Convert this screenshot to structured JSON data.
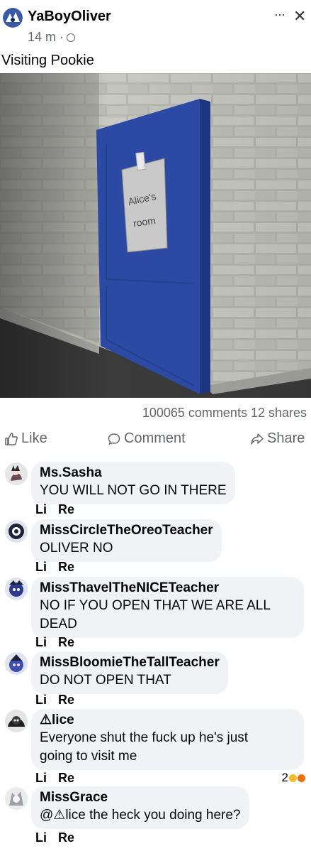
{
  "post": {
    "author": "YaBoyOliver",
    "time": "14 m ·",
    "caption": "Visiting Pookie",
    "more_icon": "···",
    "close_icon": "✕"
  },
  "image": {
    "sign_line1": "Alice's",
    "sign_line2": "room"
  },
  "stats": "100065 comments 12 shares",
  "actions": {
    "like": "Like",
    "comment": "Comment",
    "share": "Share"
  },
  "comments": [
    {
      "name": "Ms.Sasha",
      "lines": [
        "YOU WILL NOT GO IN THERE"
      ],
      "like": "Li",
      "reply": "Re"
    },
    {
      "name": "MissCircleTheOreoTeacher",
      "lines": [
        "OLIVER NO"
      ],
      "like": "Li",
      "reply": "Re"
    },
    {
      "name": "MissThavelTheNICETeacher",
      "lines": [
        "NO IF YOU OPEN THAT WE ARE ALL",
        "DEAD"
      ],
      "like": "Li",
      "reply": "Re"
    },
    {
      "name": "MissBloomieTheTallTeacher",
      "lines": [
        "DO NOT OPEN THAT"
      ],
      "like": "Li",
      "reply": "Re"
    },
    {
      "name": "⚠lice",
      "lines": [
        "Everyone shut the fuck up he's just",
        "going to visit me"
      ],
      "like": "Li",
      "reply": "Re",
      "reactions": "2"
    },
    {
      "name": "MissGrace",
      "lines": [
        "@⚠lice the heck you doing here?"
      ],
      "like": "Li",
      "reply": "Re"
    }
  ],
  "colors": {
    "door": "#2c4aa3",
    "brick": "#b9b9b3",
    "floor": "#3d3d3d",
    "bubble": "#f0f2f5",
    "muted": "#65676b"
  }
}
